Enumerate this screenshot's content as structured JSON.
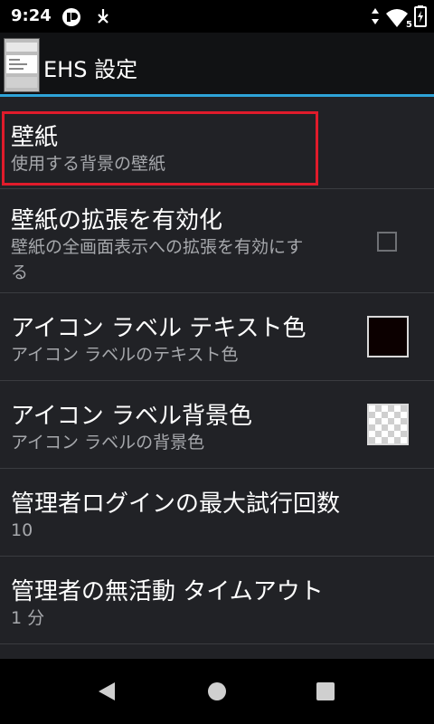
{
  "status_bar": {
    "time": "9:24",
    "icons": [
      "notification-circle-icon",
      "download-icon",
      "data-arrows-icon",
      "wifi-icon",
      "battery-charging-icon"
    ],
    "wifi_badge": "5"
  },
  "action_bar": {
    "title": "EHS 設定"
  },
  "preferences": [
    {
      "title": "壁紙",
      "summary": "使用する背景の壁紙",
      "highlighted": true
    },
    {
      "title": "壁紙の拡張を有効化",
      "summary_line1": "壁紙の全画面表示への拡張を有効にす",
      "summary_line2": "る",
      "widget": "checkbox",
      "checked": false
    },
    {
      "title": "アイコン ラベル テキスト色",
      "summary": "アイコン ラベルのテキスト色",
      "widget": "color-swatch",
      "color": "#0c0000"
    },
    {
      "title": "アイコン ラベル背景色",
      "summary": "アイコン ラベルの背景色",
      "widget": "color-swatch",
      "color": "transparent"
    },
    {
      "title": "管理者ログインの最大試行回数",
      "summary": "10"
    },
    {
      "title": "管理者の無活動 タイムアウト",
      "summary": "1 分"
    }
  ],
  "colors": {
    "accent": "#2ea3d8",
    "highlight_border": "#e01b2b",
    "background": "#212226",
    "summary_text": "#a6a8ac"
  },
  "nav_bar": {
    "icons": [
      "back-icon",
      "home-icon",
      "recents-icon"
    ]
  }
}
